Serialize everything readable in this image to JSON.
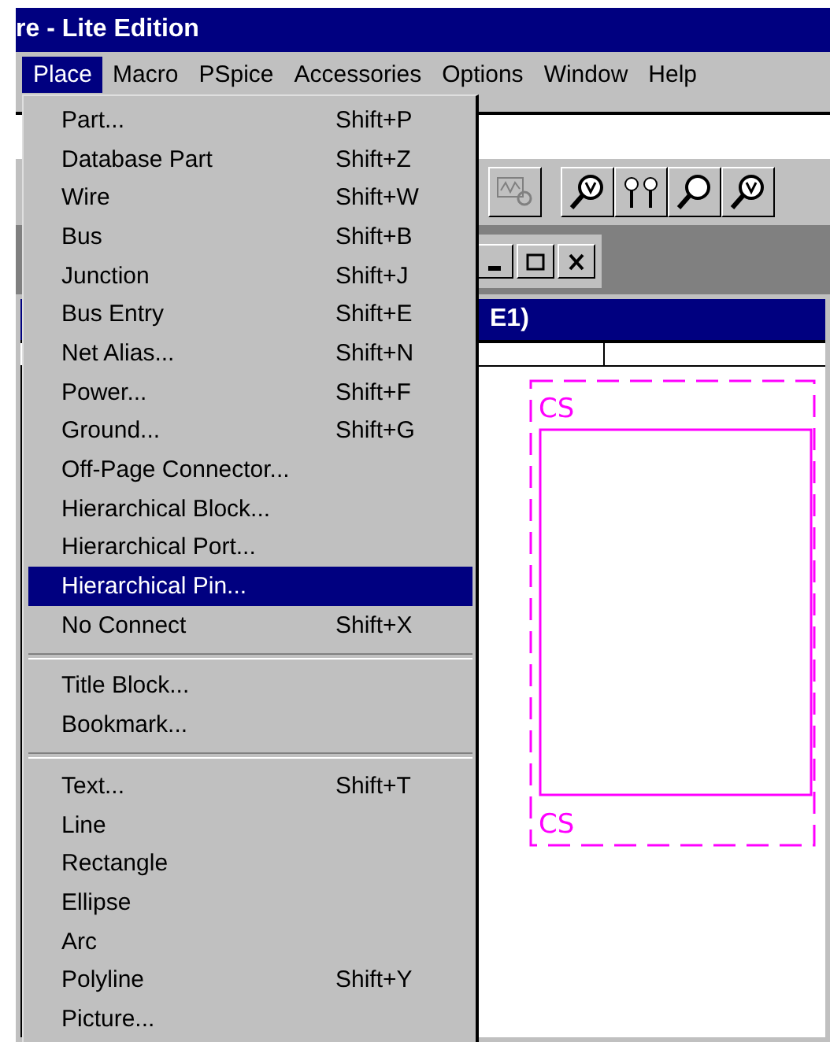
{
  "window": {
    "title": "re - Lite Edition"
  },
  "menubar": [
    {
      "label": "Place",
      "selected": true
    },
    {
      "label": "Macro",
      "selected": false
    },
    {
      "label": "PSpice",
      "selected": false
    },
    {
      "label": "Accessories",
      "selected": false
    },
    {
      "label": "Options",
      "selected": false
    },
    {
      "label": "Window",
      "selected": false
    },
    {
      "label": "Help",
      "selected": false
    }
  ],
  "place_menu": {
    "groups": [
      [
        {
          "label": "Part...",
          "shortcut": "Shift+P",
          "selected": false
        },
        {
          "label": "Database Part",
          "shortcut": "Shift+Z",
          "selected": false
        },
        {
          "label": "Wire",
          "shortcut": "Shift+W",
          "selected": false
        },
        {
          "label": "Bus",
          "shortcut": "Shift+B",
          "selected": false
        },
        {
          "label": "Junction",
          "shortcut": "Shift+J",
          "selected": false
        },
        {
          "label": "Bus Entry",
          "shortcut": "Shift+E",
          "selected": false
        },
        {
          "label": "Net Alias...",
          "shortcut": "Shift+N",
          "selected": false
        },
        {
          "label": "Power...",
          "shortcut": "Shift+F",
          "selected": false
        },
        {
          "label": "Ground...",
          "shortcut": "Shift+G",
          "selected": false
        },
        {
          "label": "Off-Page Connector...",
          "selected": false
        },
        {
          "label": "Hierarchical Block...",
          "selected": false
        },
        {
          "label": "Hierarchical Port...",
          "selected": false
        },
        {
          "label": "Hierarchical Pin...",
          "selected": true
        },
        {
          "label": "No Connect",
          "shortcut": "Shift+X",
          "selected": false
        }
      ],
      [
        {
          "label": "Title Block...",
          "selected": false
        },
        {
          "label": "Bookmark...",
          "selected": false
        }
      ],
      [
        {
          "label": "Text...",
          "shortcut": "Shift+T",
          "selected": false
        },
        {
          "label": "Line",
          "selected": false
        },
        {
          "label": "Rectangle",
          "selected": false
        },
        {
          "label": "Ellipse",
          "selected": false
        },
        {
          "label": "Arc",
          "selected": false
        },
        {
          "label": "Polyline",
          "shortcut": "Shift+Y",
          "selected": false
        },
        {
          "label": "Picture...",
          "selected": false
        }
      ]
    ]
  },
  "schematic_window": {
    "title": "E1)"
  },
  "canvas": {
    "labels": [
      "CS",
      "CS"
    ]
  }
}
